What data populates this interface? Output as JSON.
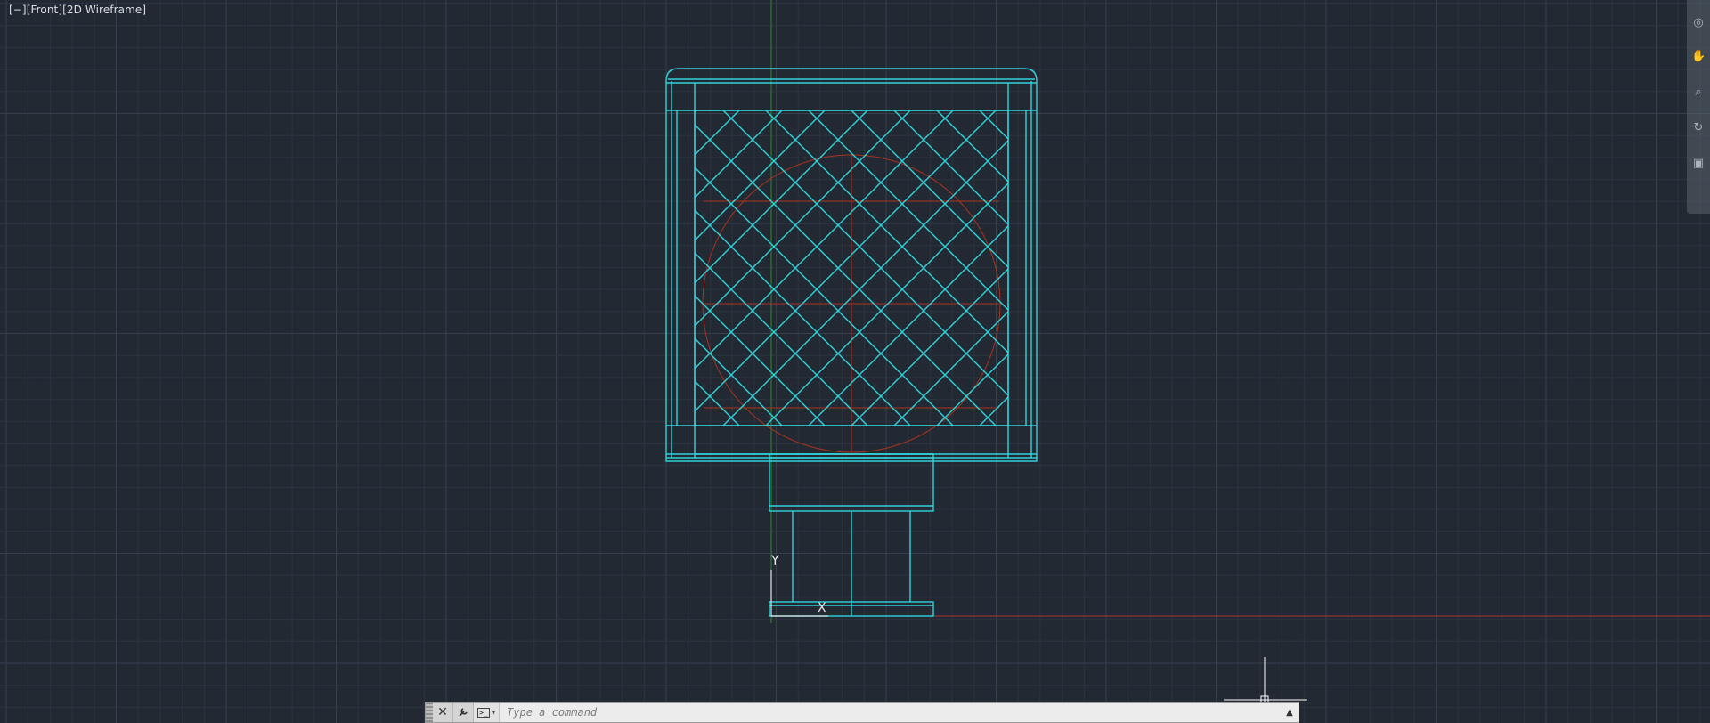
{
  "viewport": {
    "label_parts": [
      "[−]",
      "[Front]",
      "[2D Wireframe]"
    ],
    "background": "#222933",
    "grid_color": "#2c3440",
    "grid_major_color": "#34404c"
  },
  "drawing": {
    "geometry_color": "#31d3da",
    "hidden_circle_color": "#a8321e",
    "x_axis_color": "#a83232",
    "y_axis_color": "#2f8a32"
  },
  "ucs_icon": {
    "y_label": "Y",
    "x_label": "X"
  },
  "command_line": {
    "placeholder": "Type a command",
    "close_icon": "close-icon",
    "customize_icon": "wrench-icon",
    "prompt_icon": "command-prompt-icon",
    "expand_icon": "triangle-up-icon"
  },
  "navigation_bar": {
    "icons": [
      "steering-wheel-icon",
      "pan-icon",
      "zoom-icon",
      "orbit-icon",
      "showmotion-icon"
    ]
  }
}
